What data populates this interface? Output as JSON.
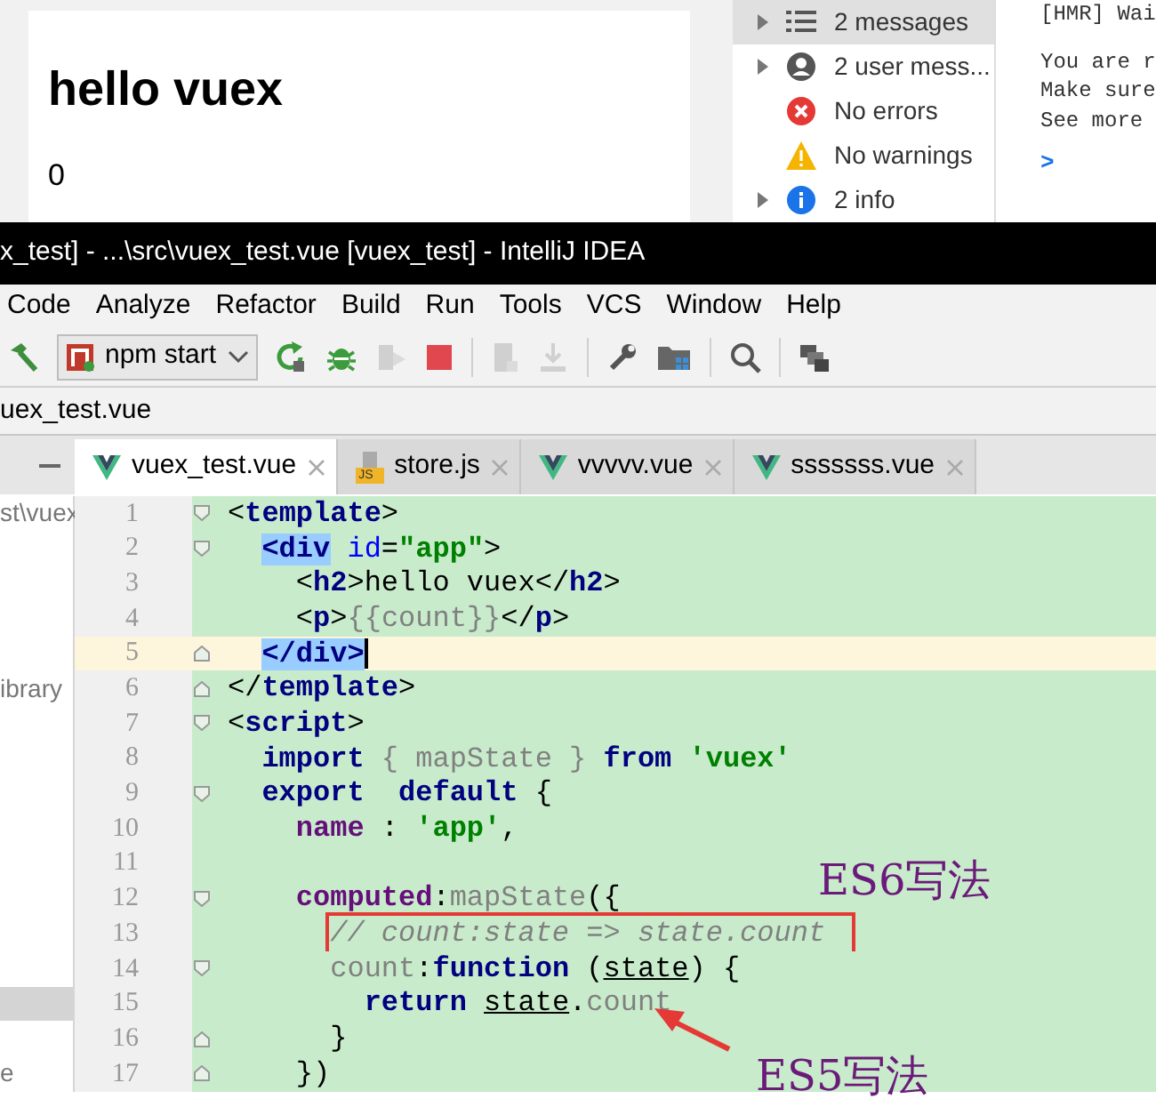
{
  "browser_page": {
    "heading": "hello vuex",
    "count": "0"
  },
  "devtools": {
    "sidebar": [
      {
        "label": "2 messages",
        "kind": "list",
        "expandable": true,
        "selected": true
      },
      {
        "label": "2 user mess...",
        "kind": "user",
        "expandable": true,
        "selected": false
      },
      {
        "label": "No errors",
        "kind": "error",
        "expandable": false,
        "selected": false
      },
      {
        "label": "No warnings",
        "kind": "warning",
        "expandable": false,
        "selected": false
      },
      {
        "label": "2 info",
        "kind": "info",
        "expandable": true,
        "selected": false
      }
    ],
    "console_lines": [
      "[HMR] Wai",
      "You are r",
      "Make sure",
      "See more"
    ],
    "prompt": ">"
  },
  "window": {
    "title": "x_test] - ...\\src\\vuex_test.vue [vuex_test] - IntelliJ IDEA"
  },
  "menu": [
    "Code",
    "Analyze",
    "Refactor",
    "Build",
    "Run",
    "Tools",
    "VCS",
    "Window",
    "Help"
  ],
  "toolbar": [
    {
      "kind": "build",
      "disabled": false
    },
    {
      "kind": "run-config",
      "label": "npm start"
    },
    {
      "kind": "rerun",
      "disabled": false
    },
    {
      "kind": "debug",
      "disabled": false
    },
    {
      "kind": "coverage",
      "disabled": true
    },
    {
      "kind": "stop",
      "disabled": false
    },
    {
      "kind": "separator"
    },
    {
      "kind": "update",
      "disabled": true
    },
    {
      "kind": "download",
      "disabled": true
    },
    {
      "kind": "separator"
    },
    {
      "kind": "settings",
      "disabled": false
    },
    {
      "kind": "structure",
      "disabled": false
    },
    {
      "kind": "separator"
    },
    {
      "kind": "search",
      "disabled": false
    },
    {
      "kind": "separator"
    },
    {
      "kind": "windows",
      "disabled": false
    }
  ],
  "breadcrumb": "uex_test.vue",
  "tabs": [
    {
      "label": "vuex_test.vue",
      "kind": "vue",
      "selected": true
    },
    {
      "label": "store.js",
      "kind": "js",
      "badge": "JS",
      "selected": false
    },
    {
      "label": "vvvvv.vue",
      "kind": "vue",
      "selected": false
    },
    {
      "label": "sssssss.vue",
      "kind": "vue",
      "selected": false
    }
  ],
  "editor": {
    "lines": [
      {
        "number": "1",
        "kind": "fold-start",
        "project_item": {
          "label": "st\\vuex",
          "selected": false
        },
        "tokens": [
          {
            "t": "<",
            "kind": "p"
          },
          {
            "t": "template",
            "kind": "tag"
          },
          {
            "t": ">",
            "kind": "p"
          }
        ]
      },
      {
        "number": "2",
        "kind": "fold-start",
        "tokens": [
          {
            "t": "  <div",
            "kind": "tag",
            "hl": true
          },
          {
            "t": " id",
            "kind": "attr"
          },
          {
            "t": "=",
            "kind": "p"
          },
          {
            "t": "\"app\"",
            "kind": "str"
          },
          {
            "t": ">",
            "kind": "p"
          }
        ]
      },
      {
        "number": "3",
        "kind": "plain",
        "tokens": [
          {
            "t": "    <",
            "kind": "p"
          },
          {
            "t": "h2",
            "kind": "tag"
          },
          {
            "t": ">hello vuex</",
            "kind": "p"
          },
          {
            "t": "h2",
            "kind": "tag"
          },
          {
            "t": ">",
            "kind": "p"
          }
        ]
      },
      {
        "number": "4",
        "kind": "plain",
        "tokens": [
          {
            "t": "    <",
            "kind": "p"
          },
          {
            "t": "p",
            "kind": "tag"
          },
          {
            "t": ">",
            "kind": "p"
          },
          {
            "t": "{{count}}",
            "kind": "tv"
          },
          {
            "t": "</",
            "kind": "p"
          },
          {
            "t": "p",
            "kind": "tag"
          },
          {
            "t": ">",
            "kind": "p"
          }
        ]
      },
      {
        "number": "5",
        "kind": "fold-end",
        "current": true,
        "tokens": [
          {
            "t": "  </div>",
            "kind": "tag",
            "hl": true
          }
        ]
      },
      {
        "number": "6",
        "kind": "fold-end",
        "project_item": {
          "label": "ibrary",
          "selected": false
        },
        "tokens": [
          {
            "t": "</",
            "kind": "p"
          },
          {
            "t": "template",
            "kind": "tag"
          },
          {
            "t": ">",
            "kind": "p"
          }
        ]
      },
      {
        "number": "7",
        "kind": "fold-start",
        "tokens": [
          {
            "t": "<",
            "kind": "p"
          },
          {
            "t": "script",
            "kind": "tag"
          },
          {
            "t": ">",
            "kind": "p"
          }
        ]
      },
      {
        "number": "8",
        "kind": "plain",
        "tokens": [
          {
            "t": "  import",
            "kind": "kw"
          },
          {
            "t": " { mapState }",
            "kind": "tv"
          },
          {
            "t": " from",
            "kind": "kw"
          },
          {
            "t": " 'vuex'",
            "kind": "str"
          }
        ]
      },
      {
        "number": "9",
        "kind": "fold-start",
        "tokens": [
          {
            "t": "  export",
            "kind": "kw"
          },
          {
            "t": "  default",
            "kind": "kw"
          },
          {
            "t": " {",
            "kind": "p"
          }
        ]
      },
      {
        "number": "10",
        "kind": "plain",
        "tokens": [
          {
            "t": "    name",
            "kind": "prop"
          },
          {
            "t": " : ",
            "kind": "p"
          },
          {
            "t": "'app'",
            "kind": "str"
          },
          {
            "t": ",",
            "kind": "p"
          }
        ]
      },
      {
        "number": "11",
        "kind": "plain"
      },
      {
        "number": "12",
        "kind": "fold-start",
        "tokens": [
          {
            "t": "    computed",
            "kind": "prop"
          },
          {
            "t": ":",
            "kind": "p"
          },
          {
            "t": "mapState",
            "kind": "tv"
          },
          {
            "t": "({",
            "kind": "p"
          }
        ]
      },
      {
        "number": "13",
        "kind": "plain",
        "tokens": [
          {
            "t": "      // count:state => state.count",
            "kind": "cm",
            "boxed": true
          }
        ]
      },
      {
        "number": "14",
        "kind": "fold-start",
        "tokens": [
          {
            "t": "      count",
            "kind": "tv"
          },
          {
            "t": ":",
            "kind": "p"
          },
          {
            "t": "function",
            "kind": "kw"
          },
          {
            "t": " (",
            "kind": "p"
          },
          {
            "t": "state",
            "kind": "prm"
          },
          {
            "t": ") {",
            "kind": "p"
          }
        ]
      },
      {
        "number": "15",
        "kind": "plain",
        "project_item": {
          "selected": true
        },
        "tokens": [
          {
            "t": "        return",
            "kind": "kw"
          },
          {
            "t": " state",
            "kind": "prm"
          },
          {
            "t": ".",
            "kind": "p"
          },
          {
            "t": "count",
            "kind": "tv"
          }
        ]
      },
      {
        "number": "16",
        "kind": "fold-end",
        "tokens": [
          {
            "t": "      }",
            "kind": "p"
          }
        ]
      },
      {
        "number": "17",
        "kind": "fold-end",
        "project_item": {
          "label": "e",
          "selected": false
        },
        "tokens": [
          {
            "t": "    })",
            "kind": "p"
          }
        ]
      }
    ],
    "annotations": [
      {
        "text": "ES6写法",
        "kind": "label"
      },
      {
        "text": "ES5写法",
        "kind": "label"
      },
      {
        "kind": "arrow"
      }
    ]
  }
}
